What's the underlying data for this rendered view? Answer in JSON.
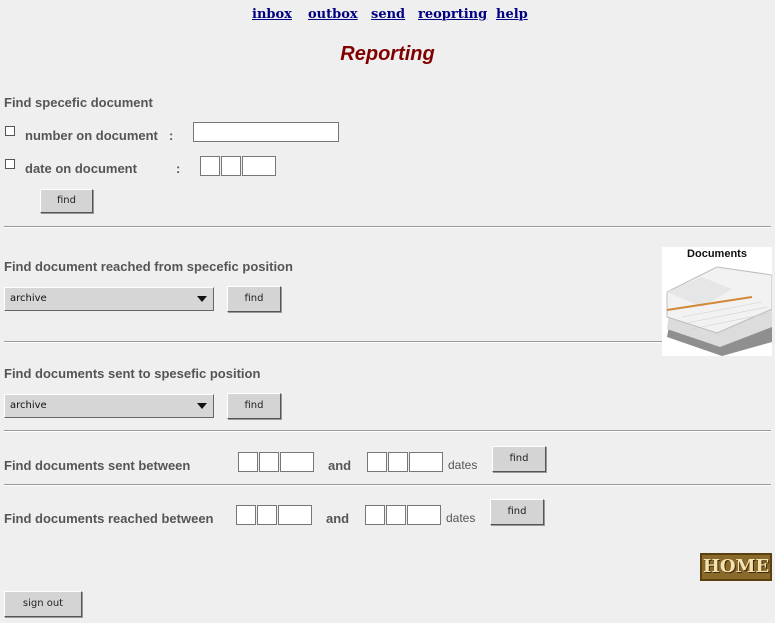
{
  "nav": {
    "inbox": "inbox",
    "outbox": "outbox",
    "send": "send",
    "reporting": "reoprting",
    "help": "help"
  },
  "page_title": "Reporting",
  "section1": {
    "heading": "Find specefic document",
    "number_label": "number on document",
    "number_colon": ":",
    "date_label": "date on document",
    "date_colon": ":",
    "number_value": "",
    "find_label": "find"
  },
  "section2": {
    "heading": "Find document reached from specefic position",
    "select_value": "archive",
    "find_label": "find"
  },
  "section3": {
    "heading": "Find documents sent to spesefic position",
    "select_value": "archive",
    "find_label": "find"
  },
  "section4": {
    "heading": "Find documents sent between",
    "and_label": "and",
    "dates_label": "dates",
    "find_label": "find"
  },
  "section5": {
    "heading": "Find documents reached between",
    "and_label": "and",
    "dates_label": "dates",
    "find_label": "find"
  },
  "image_title": "Documents",
  "home_label": "HOME",
  "signout_label": "sign out"
}
